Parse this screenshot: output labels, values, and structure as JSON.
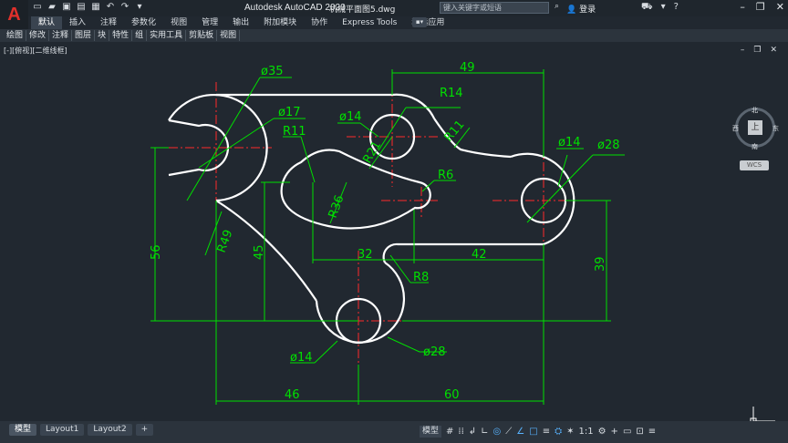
{
  "app": {
    "logo": "A",
    "title": "Autodesk AutoCAD 2020",
    "filename": "机械平面图5.dwg",
    "search_placeholder": "键入关键字或短语",
    "login": "登录",
    "quick_access_icons": [
      "new-icon",
      "open-icon",
      "save-icon",
      "save-as-icon",
      "plot-icon",
      "undo-icon",
      "redo-icon",
      "share-icon"
    ]
  },
  "ribbon": {
    "tabs": [
      "默认",
      "插入",
      "注释",
      "参数化",
      "视图",
      "管理",
      "输出",
      "附加模块",
      "协作",
      "Express Tools",
      "精选应用"
    ],
    "active_tab": "默认"
  },
  "panels": [
    "绘图",
    "修改",
    "注释",
    "图层",
    "块",
    "特性",
    "组",
    "实用工具",
    "剪贴板",
    "视图"
  ],
  "viewport": {
    "label": "[-][俯视][二维线框]",
    "viewcube": {
      "top": "上",
      "north": "北",
      "south": "南",
      "west": "西",
      "east": "东",
      "wcs": "WCS"
    }
  },
  "dimensions": {
    "d35": "ø35",
    "d17": "ø17",
    "r11a": "R11",
    "r11b": "R11",
    "d14a": "ø14",
    "r14": "R14",
    "r21": "R21",
    "r36": "R36",
    "r6": "R6",
    "d14b": "ø14",
    "d28a": "ø28",
    "r49": "R49",
    "n49": "49",
    "n56": "56",
    "n45": "45",
    "n32": "32",
    "n42": "42",
    "r8": "R8",
    "n39": "39",
    "d14c": "ø14",
    "d28b": "ø28",
    "n46": "46",
    "n60": "60"
  },
  "layout_tabs": [
    "模型",
    "Layout1",
    "Layout2",
    "+"
  ],
  "active_layout": "模型",
  "status": {
    "model_button": "模型",
    "scale": "1:1"
  },
  "colors": {
    "background": "#212830",
    "geometry": "#ffffff",
    "dimension": "#00e000",
    "centerline": "#ff2a2a"
  }
}
